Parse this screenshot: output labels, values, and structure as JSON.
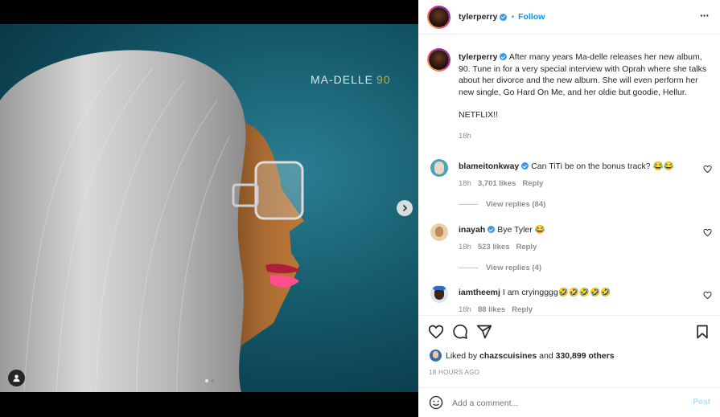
{
  "media": {
    "album_name": "MA-DELLE",
    "album_number": "90",
    "dots": [
      true,
      false
    ]
  },
  "header": {
    "username": "tylerperry",
    "separator": "•",
    "follow_label": "Follow",
    "more_label": "···"
  },
  "caption": {
    "username": "tylerperry",
    "text": "After many years Ma-delle releases her new album, 90. Tune in for a very special interview with Oprah where she talks about her divorce and the new album. She will even perform her new single, Go Hard On Me, and her oldie but goodie, Hellur.",
    "text2": "NETFLIX!!",
    "time": "18h"
  },
  "comments": [
    {
      "username": "blameitonkway",
      "text": "Can TiTi be on the bonus track? 😂😂",
      "time": "18h",
      "likes": "3,701 likes",
      "reply": "Reply",
      "view_replies": "View replies (84)"
    },
    {
      "username": "inayah",
      "text": "Bye Tyler 😂",
      "time": "18h",
      "likes": "523 likes",
      "reply": "Reply",
      "view_replies": "View replies (4)"
    },
    {
      "username": "iamtheemj",
      "text": "I am cryingggg🤣🤣🤣🤣🤣",
      "time": "18h",
      "likes": "88 likes",
      "reply": "Reply"
    }
  ],
  "likes": {
    "prefix": "Liked by",
    "user": "chazscuisines",
    "middle": "and",
    "count": "330,899 others"
  },
  "post_time": "18 HOURS AGO",
  "add_comment": {
    "placeholder": "Add a comment...",
    "post_label": "Post"
  },
  "colors": {
    "accent": "#0095f6",
    "verified": "#3897f0",
    "muted": "#8e8e8e"
  }
}
